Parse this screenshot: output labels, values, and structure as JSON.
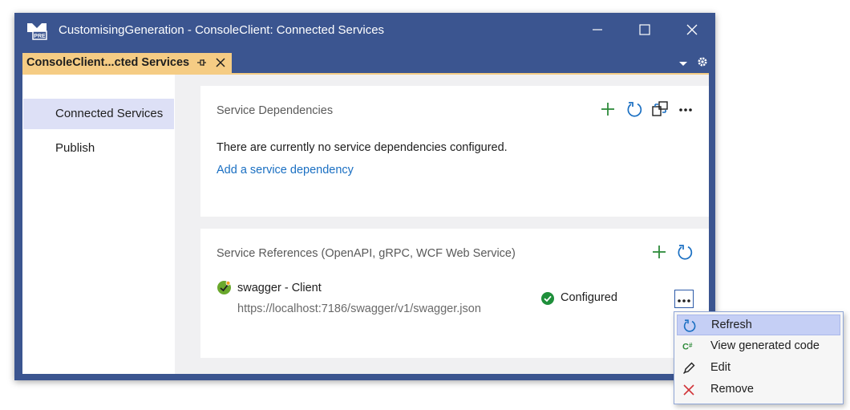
{
  "window": {
    "title": "CustomisingGeneration - ConsoleClient: Connected Services",
    "app_icon_label": "PRE"
  },
  "tab": {
    "label": "ConsoleClient...cted Services"
  },
  "sidebar": {
    "items": [
      {
        "label": "Connected Services",
        "active": true
      },
      {
        "label": "Publish",
        "active": false
      }
    ]
  },
  "service_dependencies": {
    "title": "Service Dependencies",
    "empty_message": "There are currently no service dependencies configured.",
    "add_link": "Add a service dependency"
  },
  "service_references": {
    "title": "Service References (OpenAPI, gRPC, WCF Web Service)",
    "items": [
      {
        "name": "swagger - Client",
        "url": "https://localhost:7186/swagger/v1/swagger.json",
        "status": "Configured"
      }
    ]
  },
  "context_menu": {
    "items": [
      {
        "label": "Refresh",
        "icon": "refresh-icon",
        "hover": true
      },
      {
        "label": "View generated code",
        "icon": "csharp-icon",
        "hover": false
      },
      {
        "label": "Edit",
        "icon": "pencil-icon",
        "hover": false
      },
      {
        "label": "Remove",
        "icon": "remove-x-icon",
        "hover": false
      }
    ]
  },
  "colors": {
    "titlebar": "#3b5590",
    "tab_active": "#f5cc84",
    "accent_green": "#2e8b3a",
    "accent_blue": "#1a6fc2",
    "remove_red": "#d13438"
  }
}
